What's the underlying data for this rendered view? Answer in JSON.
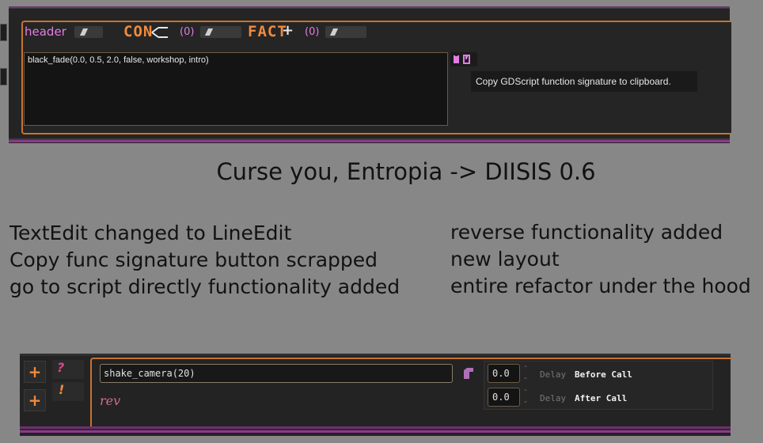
{
  "old_ui": {
    "header_label": "header",
    "con_label": "CON",
    "fact_label": "FACT",
    "con_count": "(0)",
    "fact_count": "(0)",
    "signature_text": "black_fade(0.0, 0.5, 2.0, false, workshop, intro)",
    "tooltip": "Copy GDScript function signature to clipboard."
  },
  "caption": {
    "title": "Curse you, Entropia -> DIISIS 0.6",
    "left_lines": [
      "TextEdit changed to LineEdit",
      "Copy func signature button scrapped",
      "go to script directly functionality added"
    ],
    "right_lines": [
      "reverse functionality added",
      "new layout",
      "entire refactor under the hood"
    ]
  },
  "new_ui": {
    "function_value": "shake_camera(20)",
    "rev_label": "rev",
    "rows": [
      {
        "value": "0.0",
        "delay": "Delay",
        "call": "Before Call"
      },
      {
        "value": "0.0",
        "delay": "Delay",
        "call": "After Call"
      }
    ]
  },
  "colors": {
    "accent_orange": "#c8722e",
    "accent_pink": "#e27ee2",
    "stripe_purple": "#8a3a8a"
  }
}
